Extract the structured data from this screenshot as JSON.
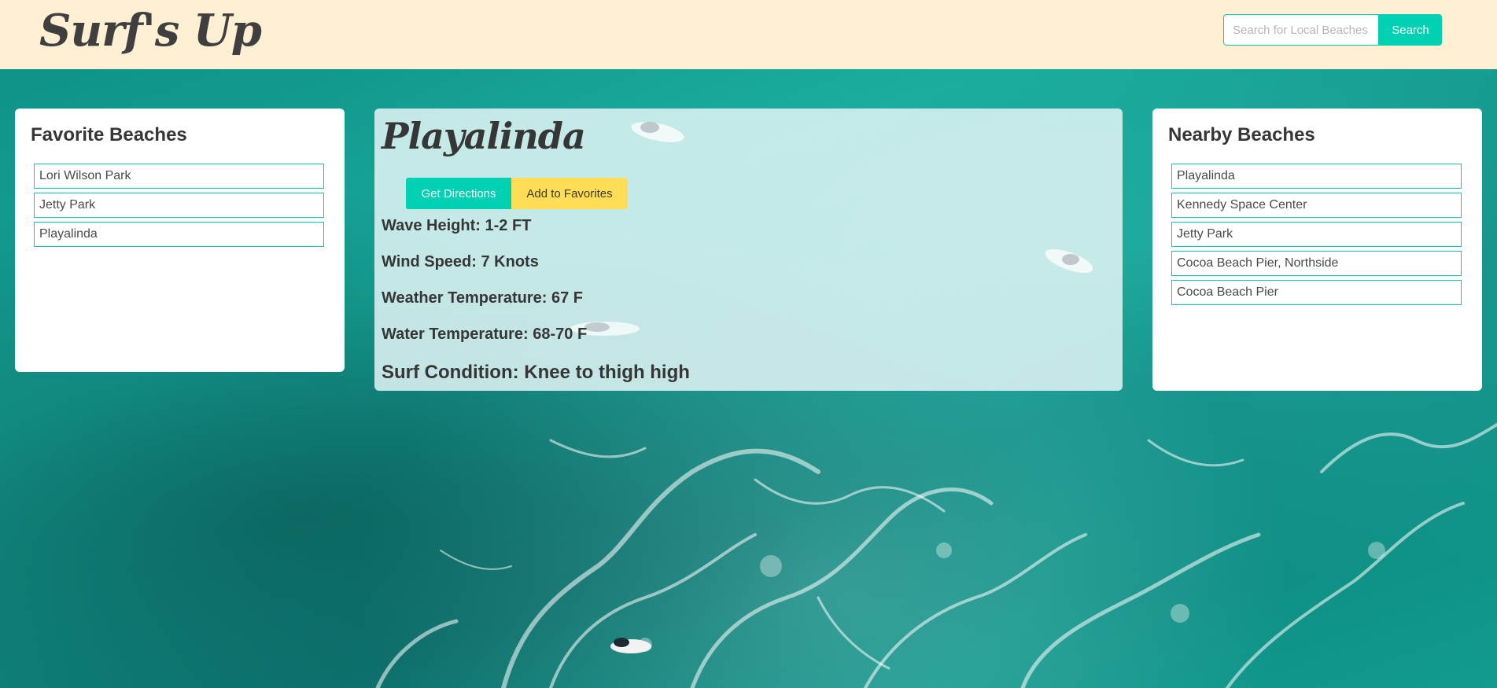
{
  "brand": {
    "title": "Surf's Up"
  },
  "search": {
    "placeholder": "Search for Local Beaches",
    "value": "",
    "button_label": "Search"
  },
  "favorites": {
    "title": "Favorite Beaches",
    "items": [
      "Lori Wilson Park",
      "Jetty Park",
      "Playalinda"
    ]
  },
  "beach": {
    "name": "Playalinda",
    "directions_label": "Get Directions",
    "favorites_label": "Add to Favorites",
    "wave_height": "Wave Height: 1-2 FT",
    "wind_speed": "Wind Speed: 7 Knots",
    "weather_temperature": "Weather Temperature: 67 F",
    "water_temperature": "Water Temperature: 68-70 F",
    "surf_condition": "Surf Condition: Knee to thigh high"
  },
  "nearby": {
    "title": "Nearby Beaches",
    "items": [
      "Playalinda",
      "Kennedy Space Center",
      "Jetty Park",
      "Cocoa Beach Pier, Northside",
      "Cocoa Beach Pier"
    ]
  },
  "colors": {
    "navbar": "#ffefd3",
    "primary": "#00d1b2",
    "warning": "#ffdd57",
    "ocean": "#119c8e",
    "text": "#363636"
  },
  "icons": [
    "surfer-icon"
  ]
}
